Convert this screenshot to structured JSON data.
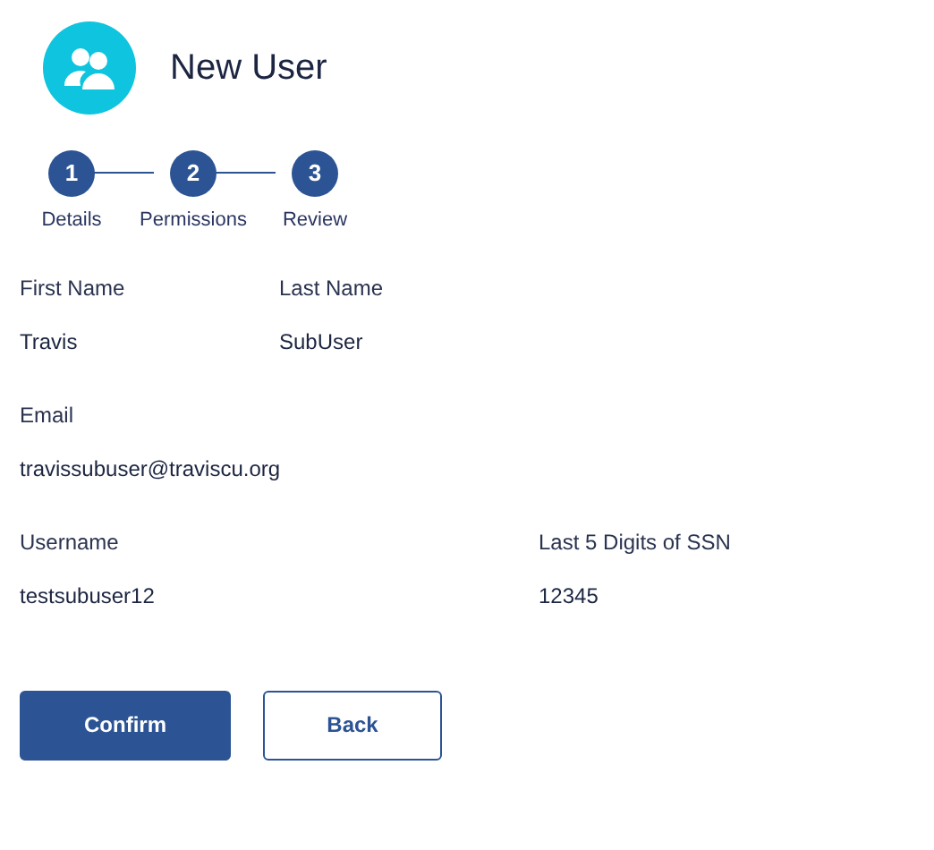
{
  "header": {
    "title": "New User"
  },
  "steps": [
    {
      "number": "1",
      "label": "Details",
      "completed": true
    },
    {
      "number": "2",
      "label": "Permissions",
      "completed": true
    },
    {
      "number": "3",
      "label": "Review",
      "completed": true
    }
  ],
  "rows": [
    [
      {
        "label": "First Name",
        "value": "Travis"
      },
      {
        "label": "Last Name",
        "value": "SubUser"
      }
    ],
    [
      {
        "label": "Email",
        "value": "travissubuser@traviscu.org"
      }
    ],
    [
      {
        "label": "Username",
        "value": "testsubuser12"
      },
      {
        "label": "Last 5 Digits of SSN",
        "value": "12345"
      }
    ]
  ],
  "buttons": [
    {
      "label": "Confirm",
      "kind": "primary"
    },
    {
      "label": "Back",
      "kind": "secondary"
    }
  ]
}
